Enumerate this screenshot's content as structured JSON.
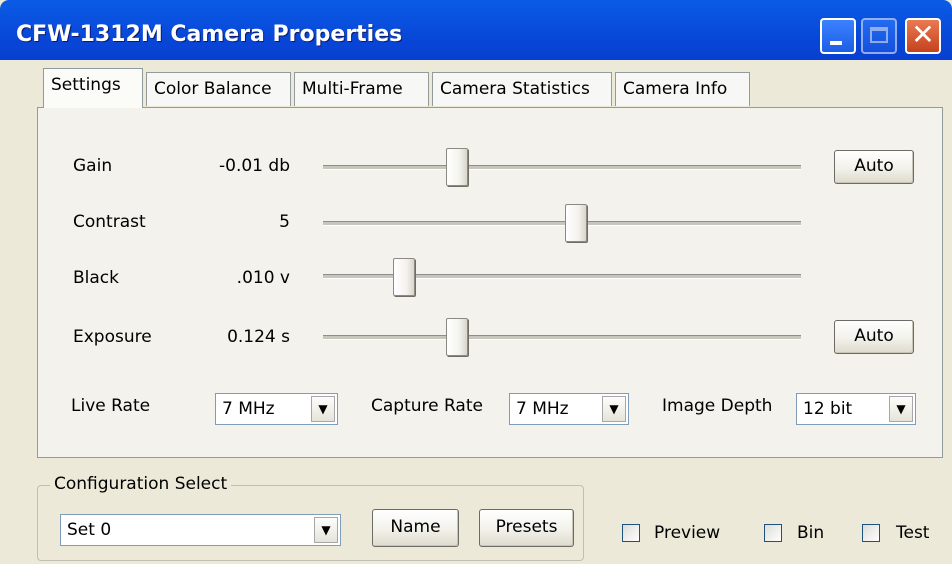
{
  "window": {
    "title": "CFW-1312M Camera Properties",
    "icons": [
      "minimize-icon",
      "maximize-icon",
      "close-icon"
    ]
  },
  "tabs": [
    {
      "label": "Settings",
      "active": true
    },
    {
      "label": "Color Balance",
      "active": false
    },
    {
      "label": "Multi-Frame",
      "active": false
    },
    {
      "label": "Camera Statistics",
      "active": false
    },
    {
      "label": "Camera Info",
      "active": false
    }
  ],
  "settings": {
    "sliders": [
      {
        "label": "Gain",
        "value": "-0.01 db",
        "position": 0.28,
        "auto": "Auto"
      },
      {
        "label": "Contrast",
        "value": "5",
        "position": 0.53,
        "auto": null
      },
      {
        "label": "Black",
        "value": ".010 v",
        "position": 0.17,
        "auto": null
      },
      {
        "label": "Exposure",
        "value": "0.124 s",
        "position": 0.28,
        "auto": "Auto"
      }
    ],
    "live_rate": {
      "label": "Live Rate",
      "value": "7 MHz"
    },
    "capture_rate": {
      "label": "Capture Rate",
      "value": "7 MHz"
    },
    "image_depth": {
      "label": "Image Depth",
      "value": "12 bit"
    }
  },
  "configuration": {
    "caption": "Configuration Select",
    "selected": "Set 0",
    "name_button": "Name",
    "presets_button": "Presets"
  },
  "checkboxes": [
    {
      "label": "Preview",
      "checked": false
    },
    {
      "label": "Bin",
      "checked": false
    },
    {
      "label": "Test",
      "checked": false
    }
  ],
  "colors": {
    "title_bar": "#0846d8",
    "panel": "#f3f2ec",
    "window_bg": "#ece9d8"
  }
}
